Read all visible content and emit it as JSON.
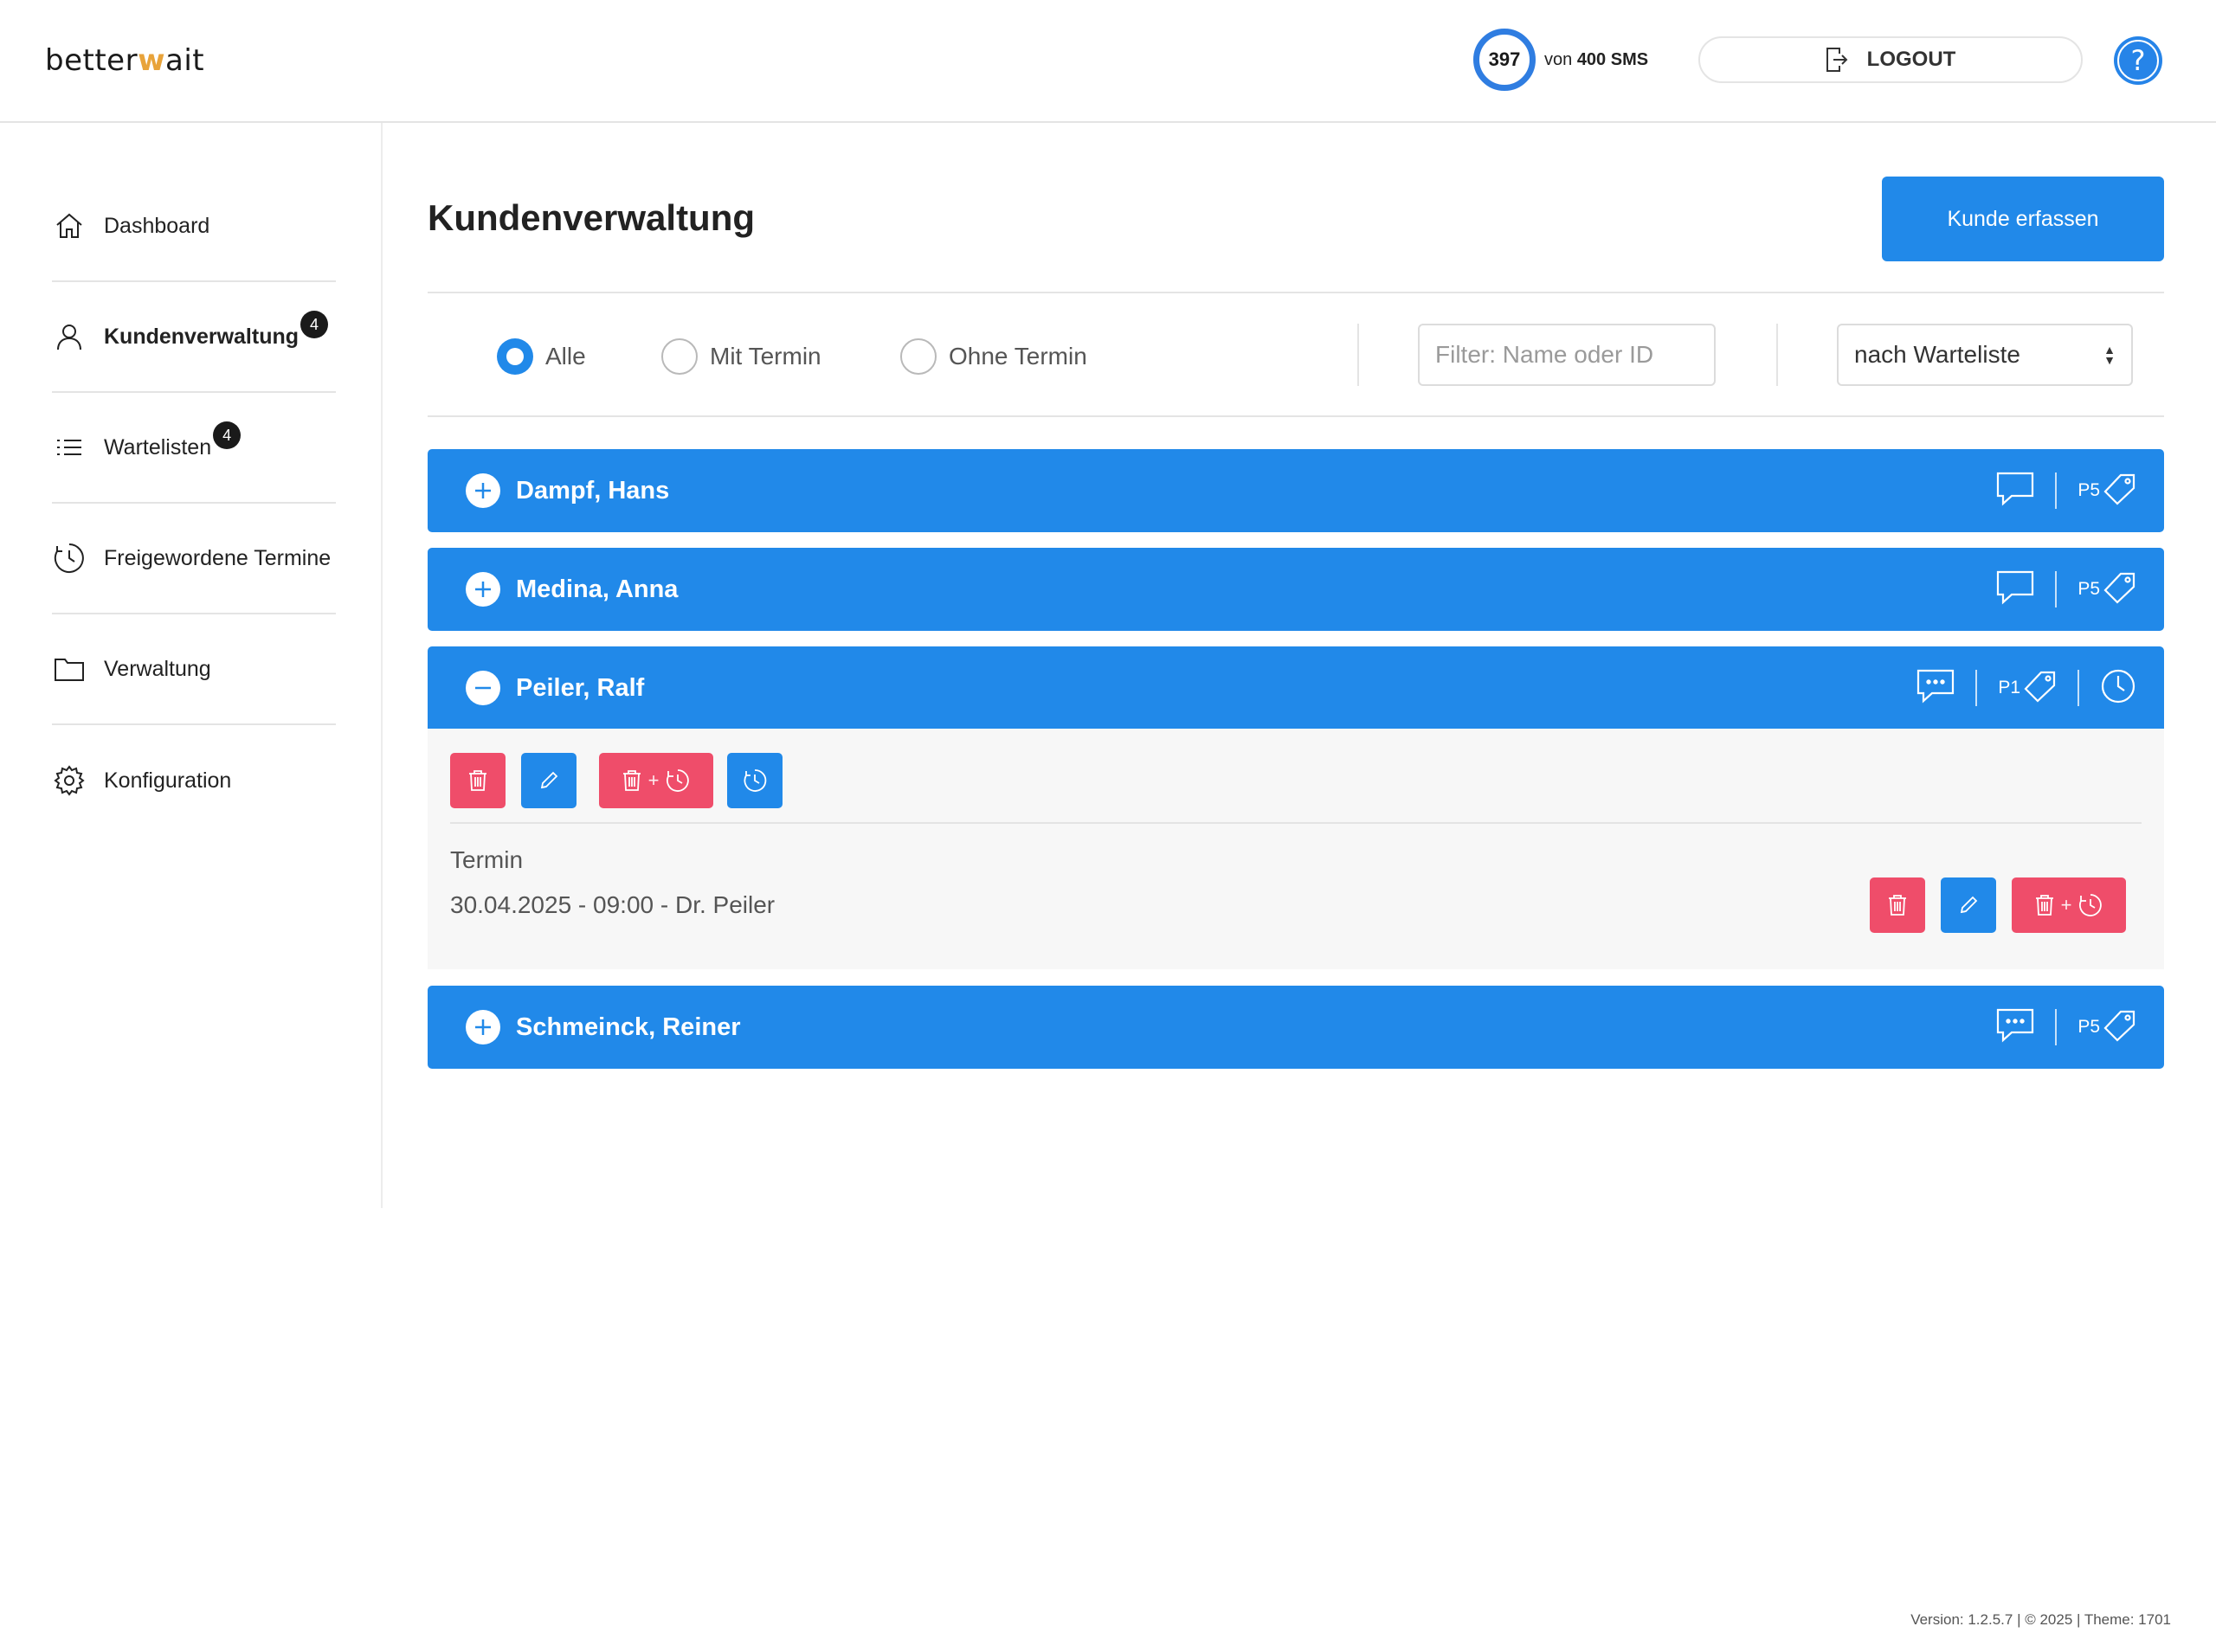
{
  "header": {
    "logo_pre": "better",
    "logo_mid": "w",
    "logo_post": "ait",
    "sms_count": "397",
    "sms_prefix": "von",
    "sms_total": "400 SMS",
    "logout_label": "LOGOUT",
    "help_label": "?"
  },
  "sidebar": {
    "items": [
      {
        "label": "Dashboard",
        "icon": "home-icon"
      },
      {
        "label": "Kundenverwaltung",
        "icon": "user-icon",
        "badge": "4",
        "active": true
      },
      {
        "label": "Wartelisten",
        "icon": "list-icon",
        "badge": "4"
      },
      {
        "label": "Freigewordene Termine",
        "icon": "clock-refresh-icon"
      },
      {
        "label": "Verwaltung",
        "icon": "folder-icon"
      },
      {
        "label": "Konfiguration",
        "icon": "gear-icon"
      }
    ]
  },
  "main": {
    "title": "Kundenverwaltung",
    "add_button": "Kunde erfassen",
    "filters": {
      "radios": [
        {
          "label": "Alle",
          "checked": true
        },
        {
          "label": "Mit Termin",
          "checked": false
        },
        {
          "label": "Ohne Termin",
          "checked": false
        }
      ],
      "search_placeholder": "Filter: Name oder ID",
      "sort_selected": "nach Warteliste"
    },
    "customers": [
      {
        "name": "Dampf, Hans",
        "priority": "P5",
        "expanded": false
      },
      {
        "name": "Medina, Anna",
        "priority": "P5",
        "expanded": false
      },
      {
        "name": "Peiler, Ralf",
        "priority": "P1",
        "expanded": true
      },
      {
        "name": "Schmeinck, Reiner",
        "priority": "P5",
        "expanded": false
      }
    ],
    "expanded_detail": {
      "termin_label": "Termin",
      "termin_value": "30.04.2025 - 09:00 - Dr. Peiler",
      "plus": "+"
    }
  },
  "footer": {
    "text": "Version: 1.2.5.7 | © 2025 | Theme: 1701"
  },
  "colors": {
    "accent": "#2189e9",
    "danger": "#ef4d6a",
    "logo_accent": "#e8a33a"
  }
}
